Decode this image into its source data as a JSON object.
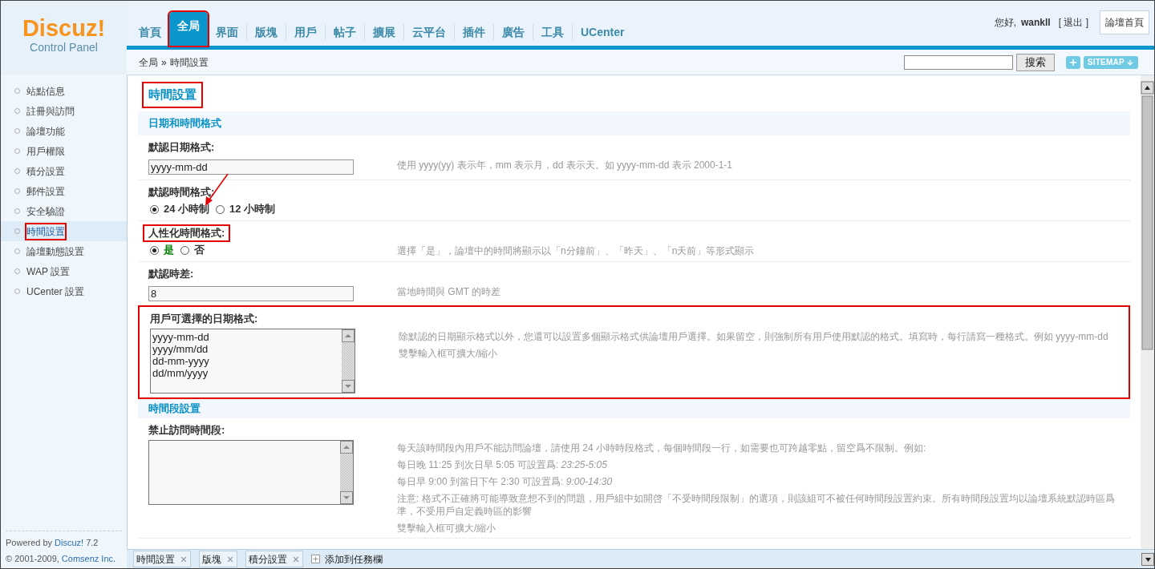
{
  "logo": {
    "name": "Discuz!",
    "subtitle": "Control Panel"
  },
  "nav": {
    "tabs": [
      {
        "label": "首頁",
        "selected": false,
        "highlighted": false
      },
      {
        "label": "全局",
        "selected": true,
        "highlighted": true
      },
      {
        "label": "界面",
        "selected": false,
        "highlighted": false
      },
      {
        "label": "版塊",
        "selected": false,
        "highlighted": false
      },
      {
        "label": "用戶",
        "selected": false,
        "highlighted": false
      },
      {
        "label": "帖子",
        "selected": false,
        "highlighted": false
      },
      {
        "label": "擴展",
        "selected": false,
        "highlighted": false
      },
      {
        "label": "云平台",
        "selected": false,
        "highlighted": false
      },
      {
        "label": "插件",
        "selected": false,
        "highlighted": false
      },
      {
        "label": "廣告",
        "selected": false,
        "highlighted": false
      },
      {
        "label": "工具",
        "selected": false,
        "highlighted": false
      },
      {
        "label": "UCenter",
        "selected": false,
        "highlighted": false
      }
    ],
    "greeting": "您好,",
    "user": "wankll",
    "logout": "[ 退出 ]",
    "home_button": "論壇首頁"
  },
  "breadcrumb": {
    "section": "全局",
    "separator": "»",
    "page": "時間設置"
  },
  "search": {
    "button": "搜索"
  },
  "sitemap": {
    "label": "SITEMAP"
  },
  "sidebar": {
    "items": [
      {
        "label": "站點信息",
        "selected": false,
        "highlighted": false
      },
      {
        "label": "註冊與訪問",
        "selected": false,
        "highlighted": false
      },
      {
        "label": "論壇功能",
        "selected": false,
        "highlighted": false
      },
      {
        "label": "用戶權限",
        "selected": false,
        "highlighted": false
      },
      {
        "label": "積分設置",
        "selected": false,
        "highlighted": false
      },
      {
        "label": "郵件設置",
        "selected": false,
        "highlighted": false
      },
      {
        "label": "安全驗證",
        "selected": false,
        "highlighted": false
      },
      {
        "label": "時間設置",
        "selected": true,
        "highlighted": true
      },
      {
        "label": "論壇動態設置",
        "selected": false,
        "highlighted": false
      },
      {
        "label": "WAP 設置",
        "selected": false,
        "highlighted": false
      },
      {
        "label": "UCenter 設置",
        "selected": false,
        "highlighted": false
      }
    ]
  },
  "footer": {
    "powered": "Powered by",
    "brand": "Discuz!",
    "version": "7.2",
    "copyright": "© 2001-2009,",
    "company": "Comsenz Inc."
  },
  "page": {
    "title": "時間設置",
    "highlighted": true,
    "rows": [
      {
        "kind": "section",
        "text": "日期和時間格式"
      },
      {
        "kind": "text",
        "label": "默認日期格式:",
        "value": "yyyy-mm-dd",
        "highlighted": false,
        "description": [
          "使用 yyyy(yy) 表示年，mm 表示月，dd 表示天。如 yyyy-mm-dd 表示 2000-1-1"
        ]
      },
      {
        "kind": "radio",
        "label": "默認時間格式:",
        "highlighted": false,
        "options": [
          {
            "label": "24 小時制",
            "selected": true,
            "color": "#333333"
          },
          {
            "label": "12 小時制",
            "selected": false,
            "color": "#333333"
          }
        ]
      },
      {
        "kind": "radio",
        "label": "人性化時間格式:",
        "highlighted": true,
        "options": [
          {
            "label": "是",
            "selected": true,
            "color": "#008000"
          },
          {
            "label": "否",
            "selected": false,
            "color": "#333333"
          }
        ],
        "description": [
          "選擇「是」，論壇中的時間將顯示以「n分鐘前」、「昨天」、「n天前」等形式顯示"
        ]
      },
      {
        "kind": "text",
        "label": "默認時差:",
        "value": "8",
        "highlighted": false,
        "description": [
          "當地時間與 GMT 的時差"
        ]
      },
      {
        "kind": "textarea",
        "label": "用戶可選擇的日期格式:",
        "value": "yyyy-mm-dd\nyyyy/mm/dd\ndd-mm-yyyy\ndd/mm/yyyy",
        "highlighted": true,
        "description": [
          "除默認的日期顯示格式以外，您還可以設置多個顯示格式供論壇用戶選擇。如果留空，則強制所有用戶使用默認的格式。填寫時，每行請寫一種格式。例如 yyyy-mm-dd",
          "雙擊輸入框可擴大/縮小"
        ]
      },
      {
        "kind": "section",
        "text": "時間段設置"
      },
      {
        "kind": "textarea",
        "label": "禁止訪問時間段:",
        "value": "",
        "highlighted": false,
        "description": [
          "每天該時間段內用戶不能訪問論壇，請使用 24 小時時段格式，每個時間段一行，如需要也可跨越零點，留空爲不限制。例如:",
          "每日晚 11:25 到次日早 5:05 可設置爲: *23:25-5:05*",
          "每日早 9:00 到當日下午 2:30 可設置爲: *9:00-14:30*",
          "注意: 格式不正確將可能導致意想不到的問題，用戶組中如開啓「不受時間段限制」的選項，則該組可不被任何時間段設置約束。所有時間段設置均以論壇系統默認時區爲準，不受用戶自定義時區的影響",
          "雙擊輸入框可擴大/縮小"
        ]
      }
    ]
  },
  "taskbar": {
    "items": [
      {
        "label": "時間設置"
      },
      {
        "label": "版塊"
      },
      {
        "label": "積分設置"
      }
    ],
    "add": "添加到任務欄"
  }
}
